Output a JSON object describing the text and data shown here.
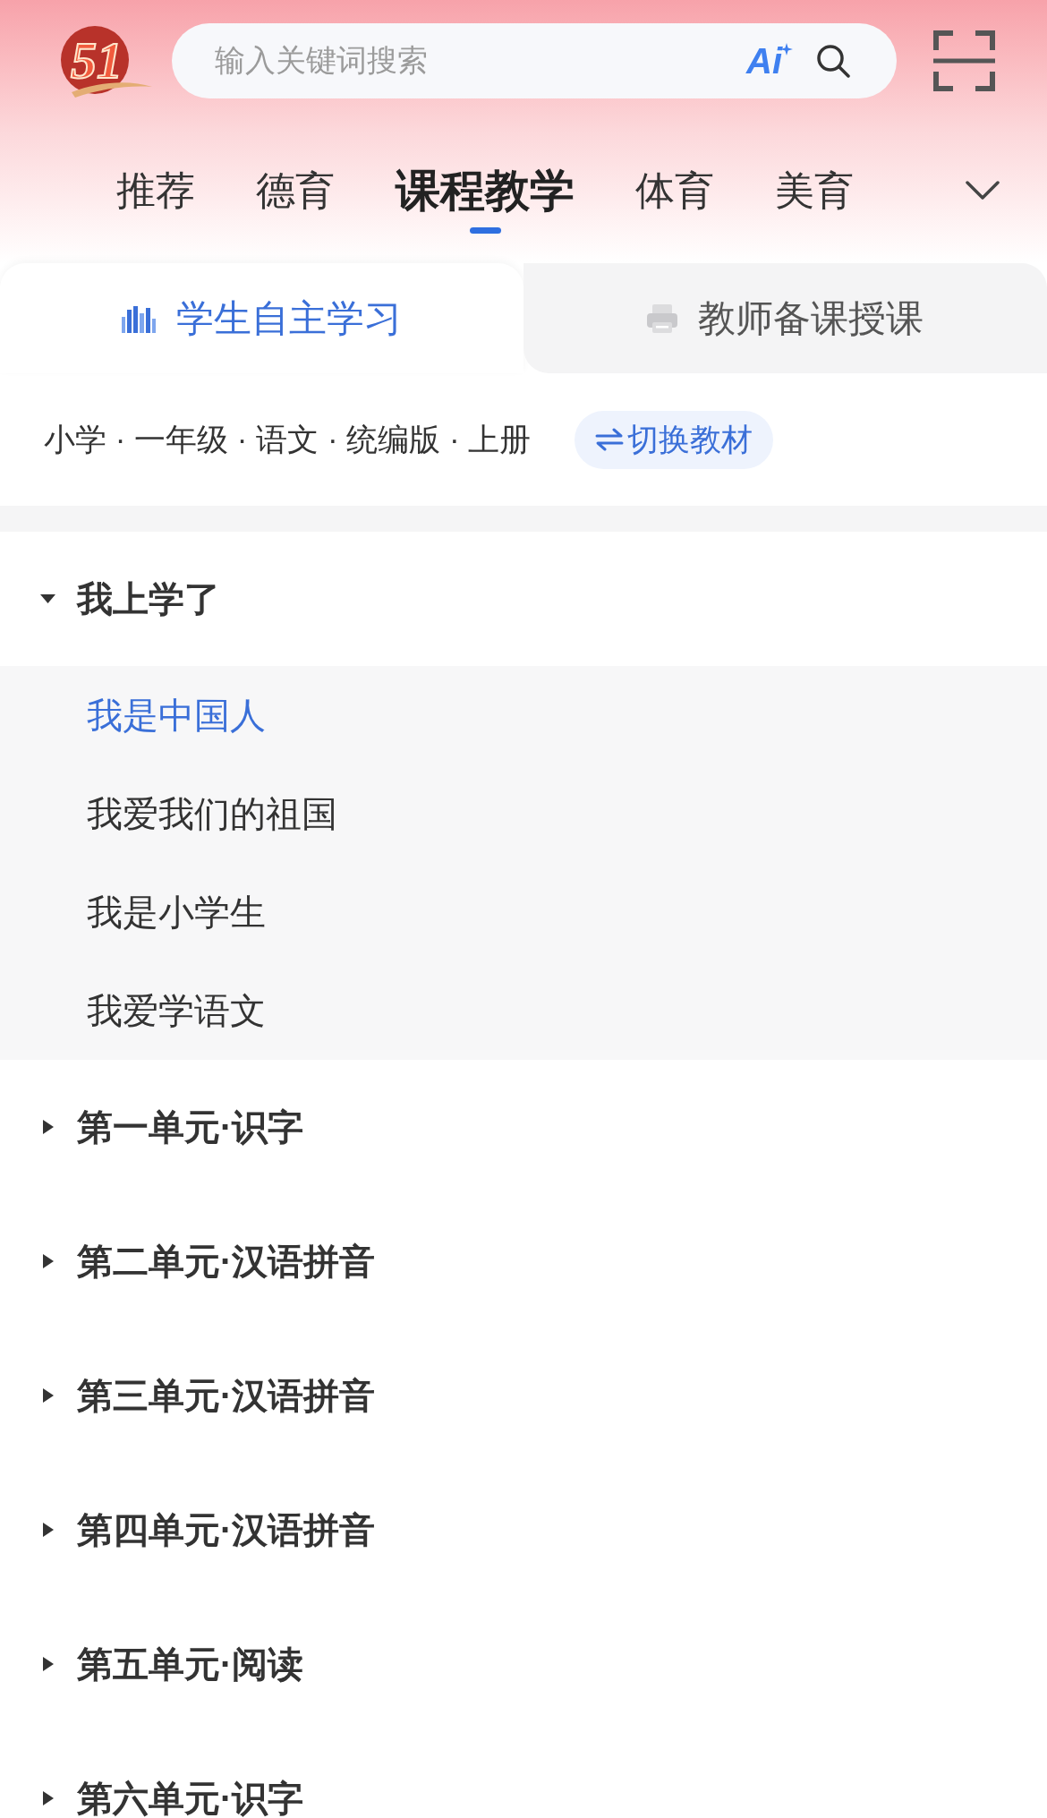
{
  "header": {
    "logo": {
      "text": "51"
    },
    "search": {
      "placeholder": "输入关键词搜索",
      "ai_label": "Ai"
    }
  },
  "categories": [
    {
      "label": "推荐",
      "selected": false
    },
    {
      "label": "德育",
      "selected": false
    },
    {
      "label": "课程教学",
      "selected": true
    },
    {
      "label": "体育",
      "selected": false
    },
    {
      "label": "美育",
      "selected": false
    }
  ],
  "modes": [
    {
      "label": "学生自主学习",
      "selected": true
    },
    {
      "label": "教师备课授课",
      "selected": false
    }
  ],
  "textbook": {
    "path": "小学 · 一年级 · 语文 · 统编版 · 上册",
    "switch_button": "切换教材"
  },
  "units": [
    {
      "title": "我上学了",
      "expanded": true,
      "children": [
        {
          "title": "我是中国人",
          "selected": true
        },
        {
          "title": "我爱我们的祖国",
          "selected": false
        },
        {
          "title": "我是小学生",
          "selected": false
        },
        {
          "title": "我爱学语文",
          "selected": false
        }
      ]
    },
    {
      "title": "第一单元·识字",
      "expanded": false
    },
    {
      "title": "第二单元·汉语拼音",
      "expanded": false
    },
    {
      "title": "第三单元·汉语拼音",
      "expanded": false
    },
    {
      "title": "第四单元·汉语拼音",
      "expanded": false
    },
    {
      "title": "第五单元·阅读",
      "expanded": false
    },
    {
      "title": "第六单元·识字",
      "expanded": false
    }
  ]
}
